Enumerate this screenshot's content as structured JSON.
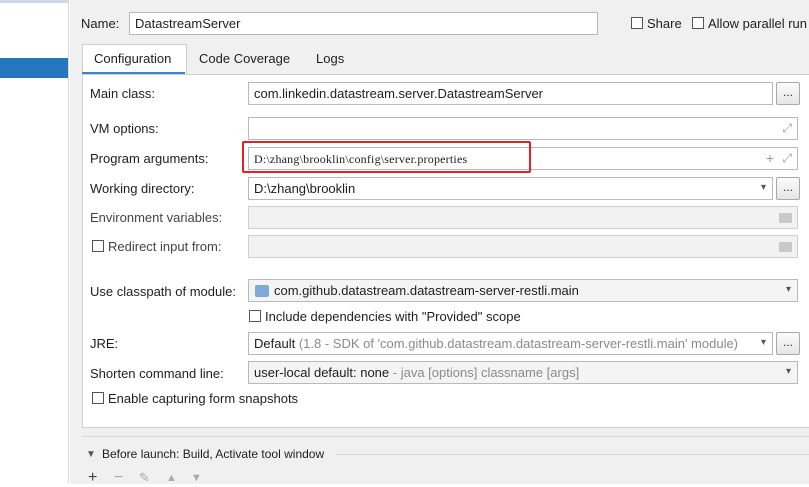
{
  "header": {
    "name_label": "Name:",
    "name_value": "DatastreamServer",
    "share_label": "Share",
    "allow_parallel_label": "Allow parallel run"
  },
  "tabs": [
    {
      "label": "Configuration"
    },
    {
      "label": "Code Coverage"
    },
    {
      "label": "Logs"
    }
  ],
  "form": {
    "main_class_label": "Main class:",
    "main_class_value": "com.linkedin.datastream.server.DatastreamServer",
    "vm_options_label": "VM options:",
    "vm_options_value": "",
    "program_args_label": "Program arguments:",
    "program_args_value": "D:\\zhang\\brooklin\\config\\server.properties",
    "working_dir_label": "Working directory:",
    "working_dir_value": "D:\\zhang\\brooklin",
    "env_vars_label": "Environment variables:",
    "redirect_label": "Redirect input from:",
    "classpath_label": "Use classpath of module:",
    "classpath_value": "com.github.datastream.datastream-server-restli.main",
    "include_deps_label": "Include dependencies with \"Provided\" scope",
    "jre_label": "JRE:",
    "jre_value_main": "Default",
    "jre_value_detail": "(1.8 - SDK of 'com.github.datastream.datastream-server-restli.main' module)",
    "shorten_label": "Shorten command line:",
    "shorten_value_main": "user-local default: none",
    "shorten_value_detail": "- java [options] classname [args]",
    "snapshots_label": "Enable capturing form snapshots",
    "browse_label": "..."
  },
  "before_launch": {
    "title": "Before launch: Build, Activate tool window"
  },
  "colors": {
    "selection": "#2675bf",
    "highlight_box": "#e0202a",
    "tab_underline": "#4083c9"
  }
}
